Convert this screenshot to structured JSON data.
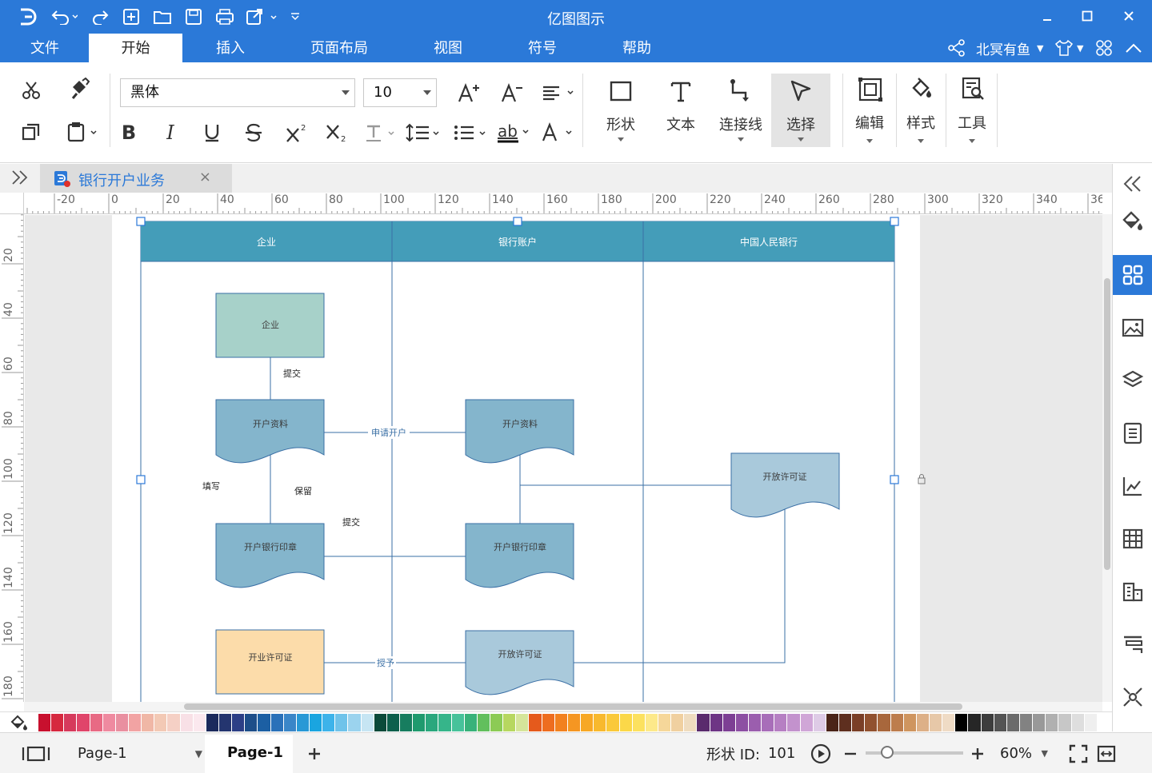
{
  "app": {
    "title": "亿图图示"
  },
  "menu": {
    "items": [
      "文件",
      "开始",
      "插入",
      "页面布局",
      "视图",
      "符号",
      "帮助"
    ],
    "active": "开始",
    "user_name": "北冥有鱼"
  },
  "ribbon": {
    "font_family": "黑体",
    "font_size": "10",
    "tools": {
      "shape": "形状",
      "text": "文本",
      "connector": "连接线",
      "select": "选择",
      "edit": "编辑",
      "style": "样式",
      "tools": "工具"
    }
  },
  "document": {
    "tab_name": "银行开户业务"
  },
  "ruler": {
    "h_labels": [
      "-20",
      "0",
      "20",
      "40",
      "60",
      "80",
      "100",
      "120",
      "140",
      "160",
      "180",
      "200",
      "220",
      "240",
      "260",
      "280",
      "300",
      "320",
      "340",
      "36"
    ],
    "v_labels": [
      "20",
      "40",
      "60",
      "80",
      "100",
      "120",
      "140",
      "160",
      "180"
    ]
  },
  "diagram": {
    "lanes": [
      "企业",
      "银行账户",
      "中国人民银行"
    ],
    "shapes": {
      "enterprise": "企业",
      "docs_left": "开户资料",
      "docs_mid": "开户资料",
      "seal_left": "开户银行印章",
      "seal_mid": "开户银行印章",
      "license_left": "开业许可证",
      "license_mid": "开放许可证",
      "license_right": "开放许可证"
    },
    "labels": {
      "submit_1": "提交",
      "apply": "申请开户",
      "fill": "填写",
      "keep": "保留",
      "submit_2": "提交",
      "grant": "授予"
    },
    "colors": {
      "header": "#449db9",
      "enterprise_fill": "#a7d1c9",
      "doc_fill": "#84b5cc",
      "light_doc_fill": "#a9c9db",
      "license_fill": "#fcdcaa",
      "line": "#3a6fa5"
    }
  },
  "status": {
    "page_tab": "Page-1",
    "active_page": "Page-1",
    "shape_id_label": "形状 ID:",
    "shape_id": "101",
    "zoom": "60%",
    "zoom_level": 0.22
  },
  "palette": [
    "#c8102e",
    "#d6283f",
    "#d63a5c",
    "#e0456a",
    "#e86a84",
    "#ef8aa0",
    "#e98fa0",
    "#f2a3a3",
    "#f0b7a6",
    "#f3c9b5",
    "#f5d0c5",
    "#f8e0e6",
    "#fbe8ee",
    "#1b2a5c",
    "#24356f",
    "#2c3f86",
    "#1d4e89",
    "#1c5fa3",
    "#2a71b9",
    "#3a86c8",
    "#2899d6",
    "#1aa5e0",
    "#3db3ea",
    "#6fc3ea",
    "#9bd3ee",
    "#c6e5f3",
    "#0b4a3a",
    "#0d5f4c",
    "#177d5f",
    "#1f9a6e",
    "#2aa77d",
    "#36b58a",
    "#47c29a",
    "#38b27a",
    "#62bf5d",
    "#8ccb55",
    "#b7d760",
    "#d5e59a",
    "#e55a1c",
    "#ee6d1f",
    "#f2811f",
    "#f59622",
    "#f7a825",
    "#f8b92e",
    "#fac93a",
    "#fbd849",
    "#fce15f",
    "#fde98a",
    "#f6d79a",
    "#f0d0a0",
    "#efdcbf",
    "#5a2b6d",
    "#6e3585",
    "#7d3f94",
    "#8d4fa3",
    "#9b5eae",
    "#a86eb9",
    "#b67fc3",
    "#c392cd",
    "#d0a6d7",
    "#decbe6",
    "#4a2418",
    "#5e2f1f",
    "#7a3f27",
    "#91512f",
    "#a8673c",
    "#bd7d4d",
    "#cf955f",
    "#ddb087",
    "#e7c8a8",
    "#efdbc5",
    "#000000",
    "#262626",
    "#3d3d3d",
    "#545454",
    "#6b6b6b",
    "#828282",
    "#999999",
    "#b0b0b0",
    "#c7c7c7",
    "#dedede",
    "#efefef",
    "#ffffff"
  ]
}
